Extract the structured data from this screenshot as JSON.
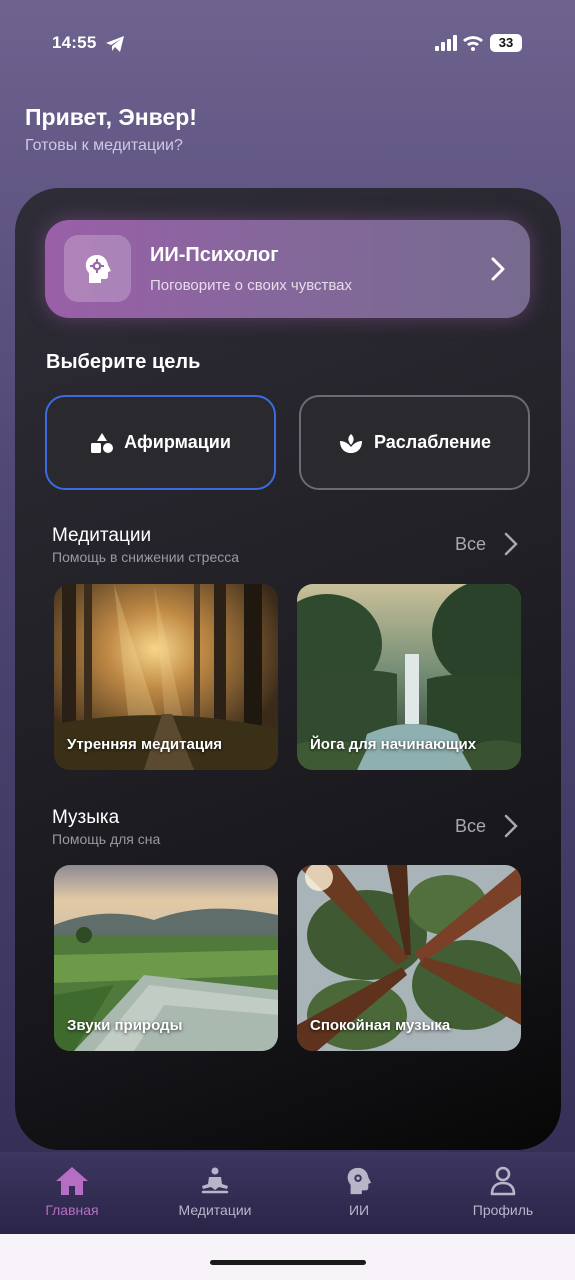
{
  "status": {
    "time": "14:55",
    "battery": "33"
  },
  "greeting": {
    "title": "Привет, Энвер!",
    "subtitle": "Готовы к медитации?"
  },
  "psychologist": {
    "title": "ИИ-Психолог",
    "subtitle": "Поговорите о своих чувствах"
  },
  "goals": {
    "title": "Выберите цель",
    "items": [
      {
        "label": "Афирмации",
        "icon": "shapes-icon"
      },
      {
        "label": "Раслабление",
        "icon": "lotus-icon"
      }
    ]
  },
  "meditations": {
    "title": "Медитации",
    "subtitle": "Помощь в снижении стресса",
    "all_label": "Все",
    "cards": [
      {
        "label": "Утренняя медитация"
      },
      {
        "label": "Йога для начинающих"
      }
    ]
  },
  "music": {
    "title": "Музыка",
    "subtitle": "Помощь для сна",
    "all_label": "Все",
    "cards": [
      {
        "label": "Звуки природы"
      },
      {
        "label": "Спокойная музыка"
      }
    ]
  },
  "tabs": [
    {
      "label": "Главная",
      "icon": "home-icon",
      "active": true
    },
    {
      "label": "Медитации",
      "icon": "meditation-icon",
      "active": false
    },
    {
      "label": "ИИ",
      "icon": "ai-head-icon",
      "active": false
    },
    {
      "label": "Профиль",
      "icon": "profile-icon",
      "active": false
    }
  ],
  "colors": {
    "accent": "#b56ec4",
    "selected_border": "#3b6be0"
  }
}
